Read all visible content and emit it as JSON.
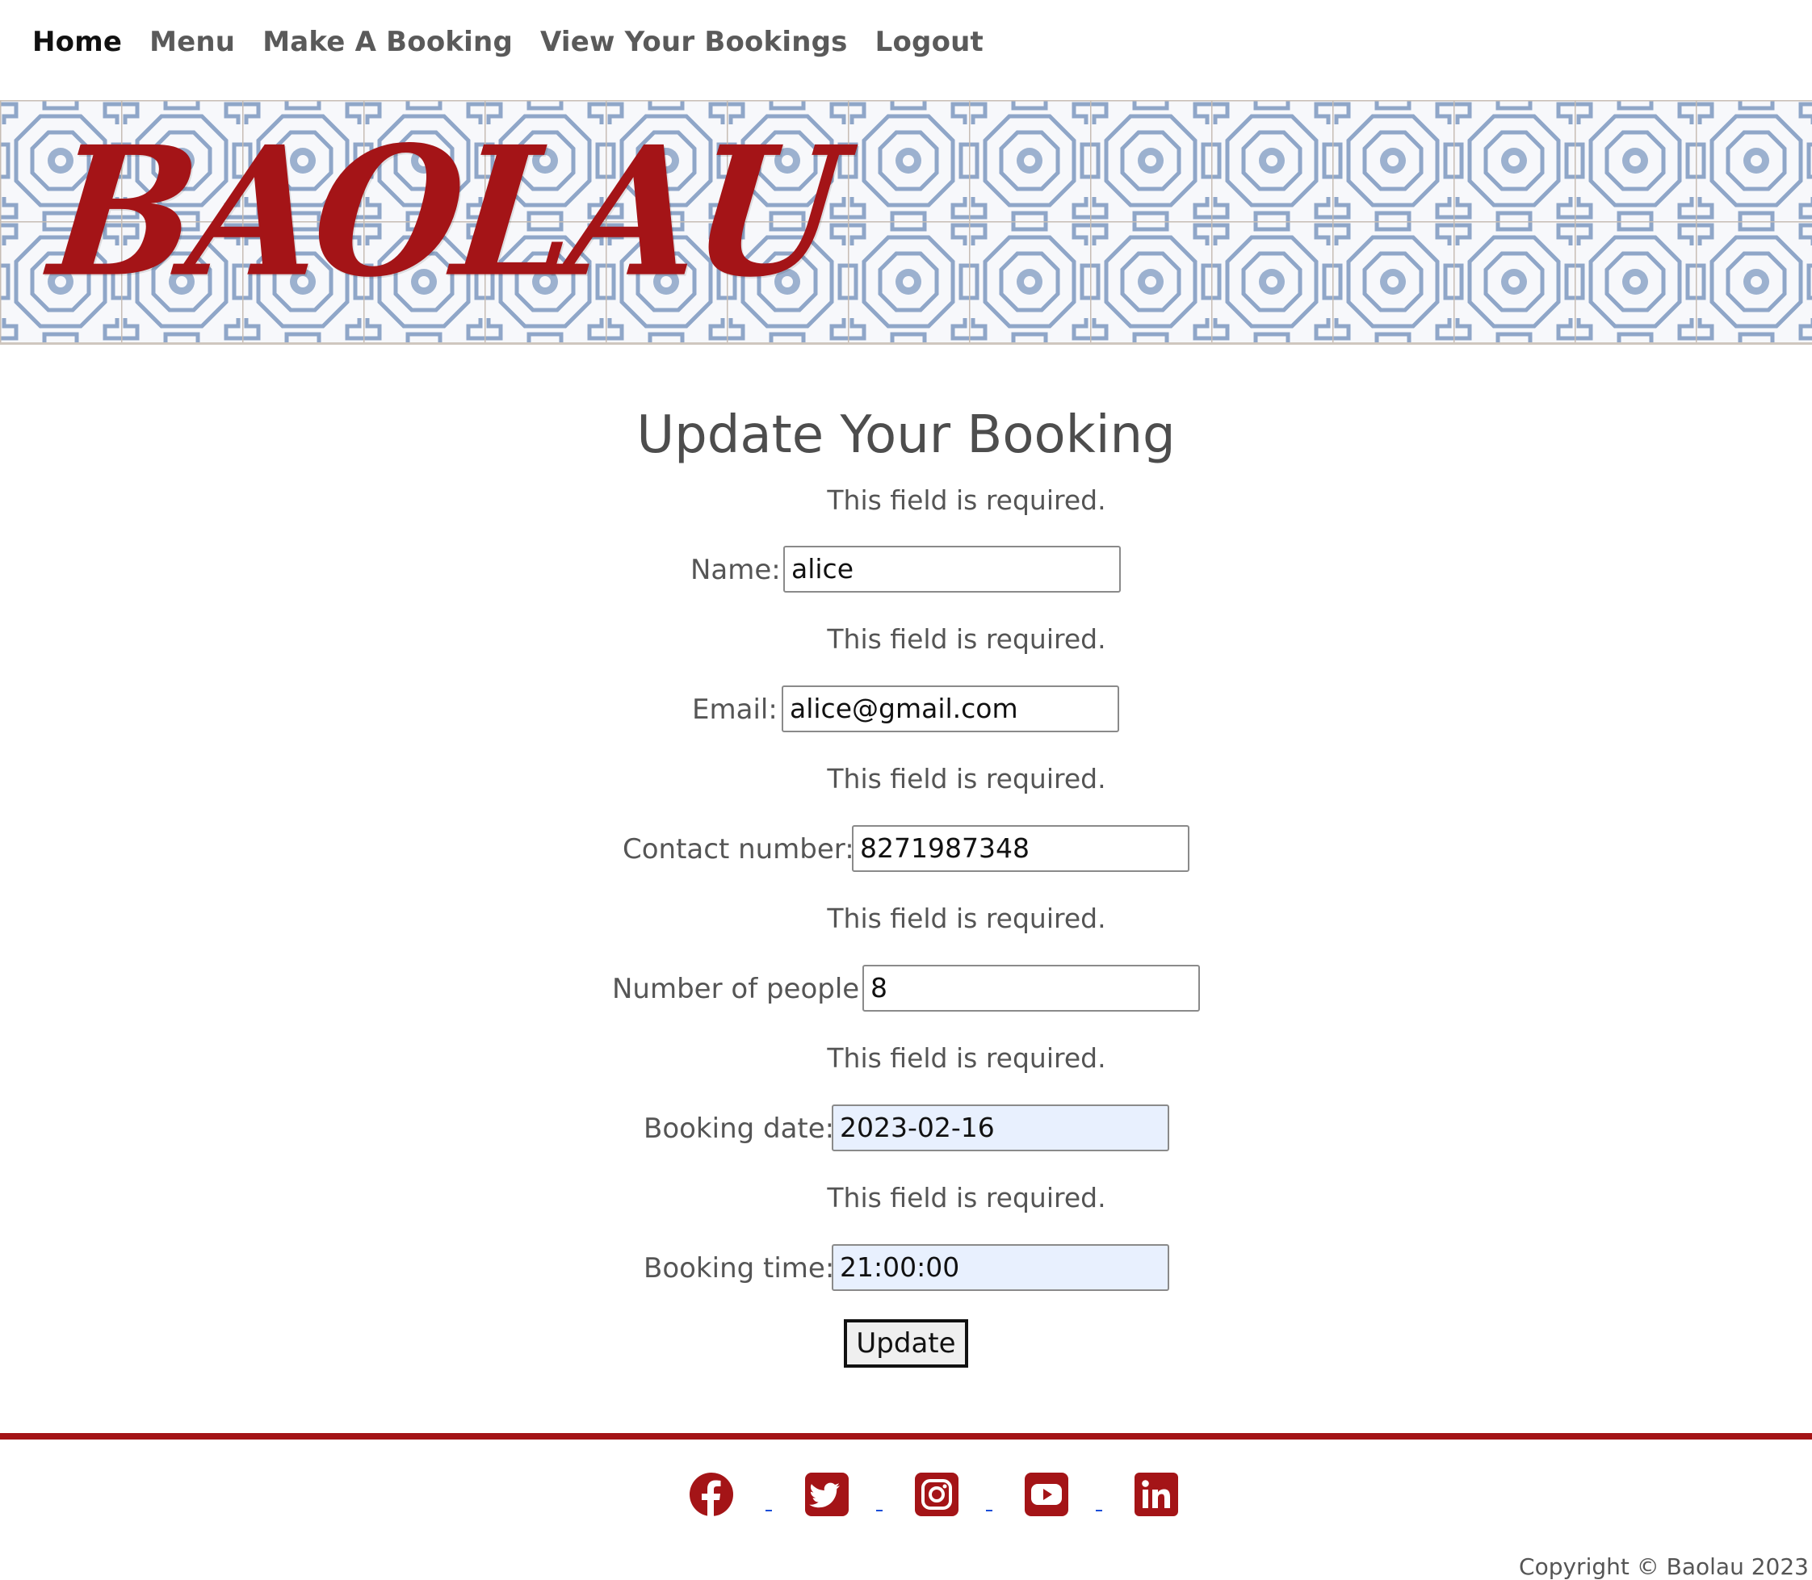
{
  "nav": {
    "items": [
      "Home",
      "Menu",
      "Make A Booking",
      "View Your Bookings",
      "Logout"
    ]
  },
  "header": {
    "logo": "BAOLAU"
  },
  "form": {
    "title": "Update Your Booking",
    "required_msg": "This field is required.",
    "fields": {
      "name": {
        "label": "Name:",
        "value": "alice"
      },
      "email": {
        "label": "Email:",
        "value": "alice@gmail.com"
      },
      "contact": {
        "label": "Contact number:",
        "value": "8271987348"
      },
      "people": {
        "label": "Number of people:",
        "value": "8"
      },
      "date": {
        "label": "Booking date:",
        "value": "2023-02-16"
      },
      "time": {
        "label": "Booking time:",
        "value": "21:00:00"
      }
    },
    "submit_label": "Update"
  },
  "footer": {
    "social_icons": [
      "facebook-icon",
      "twitter-icon",
      "instagram-icon",
      "youtube-icon",
      "linkedin-icon"
    ],
    "copyright": "Copyright © Baolau 2023"
  },
  "colors": {
    "brand_red": "#a41417",
    "tile_blue": "#8fa6c8",
    "link_blue": "#1a4ed8"
  }
}
